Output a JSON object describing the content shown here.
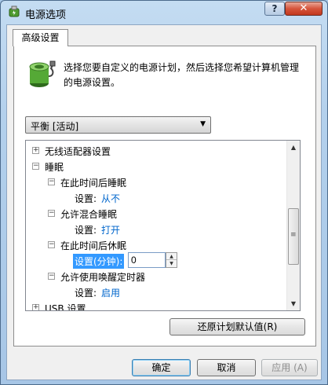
{
  "window": {
    "title": "电源选项",
    "help_label": "?",
    "close_label": "✕",
    "app_icon": "power-options-icon"
  },
  "tab": {
    "label": "高级设置"
  },
  "description": "选择您要自定义的电源计划，然后选择您希望计算机管理的电源设置。",
  "plan": {
    "selected": "平衡 [活动]"
  },
  "tree": {
    "wireless": {
      "label": "无线适配器设置"
    },
    "sleep": {
      "label": "睡眠"
    },
    "sleep_after": {
      "label": "在此时间后睡眠",
      "setting_label": "设置:",
      "setting_value": "从不"
    },
    "hybrid": {
      "label": "允许混合睡眠",
      "setting_label": "设置:",
      "setting_value": "打开"
    },
    "hibernate_after": {
      "label": "在此时间后休眠",
      "setting_label": "设置(分钟):",
      "setting_value": "0"
    },
    "wake_timers": {
      "label": "允许使用唤醒定时器",
      "setting_label": "设置:",
      "setting_value": "启用"
    },
    "usb": {
      "label": "USB 设置"
    }
  },
  "buttons": {
    "restore": "还原计划默认值(R)",
    "ok": "确定",
    "cancel": "取消",
    "apply": "应用 (A)"
  },
  "colors": {
    "link": "#0066cc",
    "selection": "#3399ff"
  }
}
